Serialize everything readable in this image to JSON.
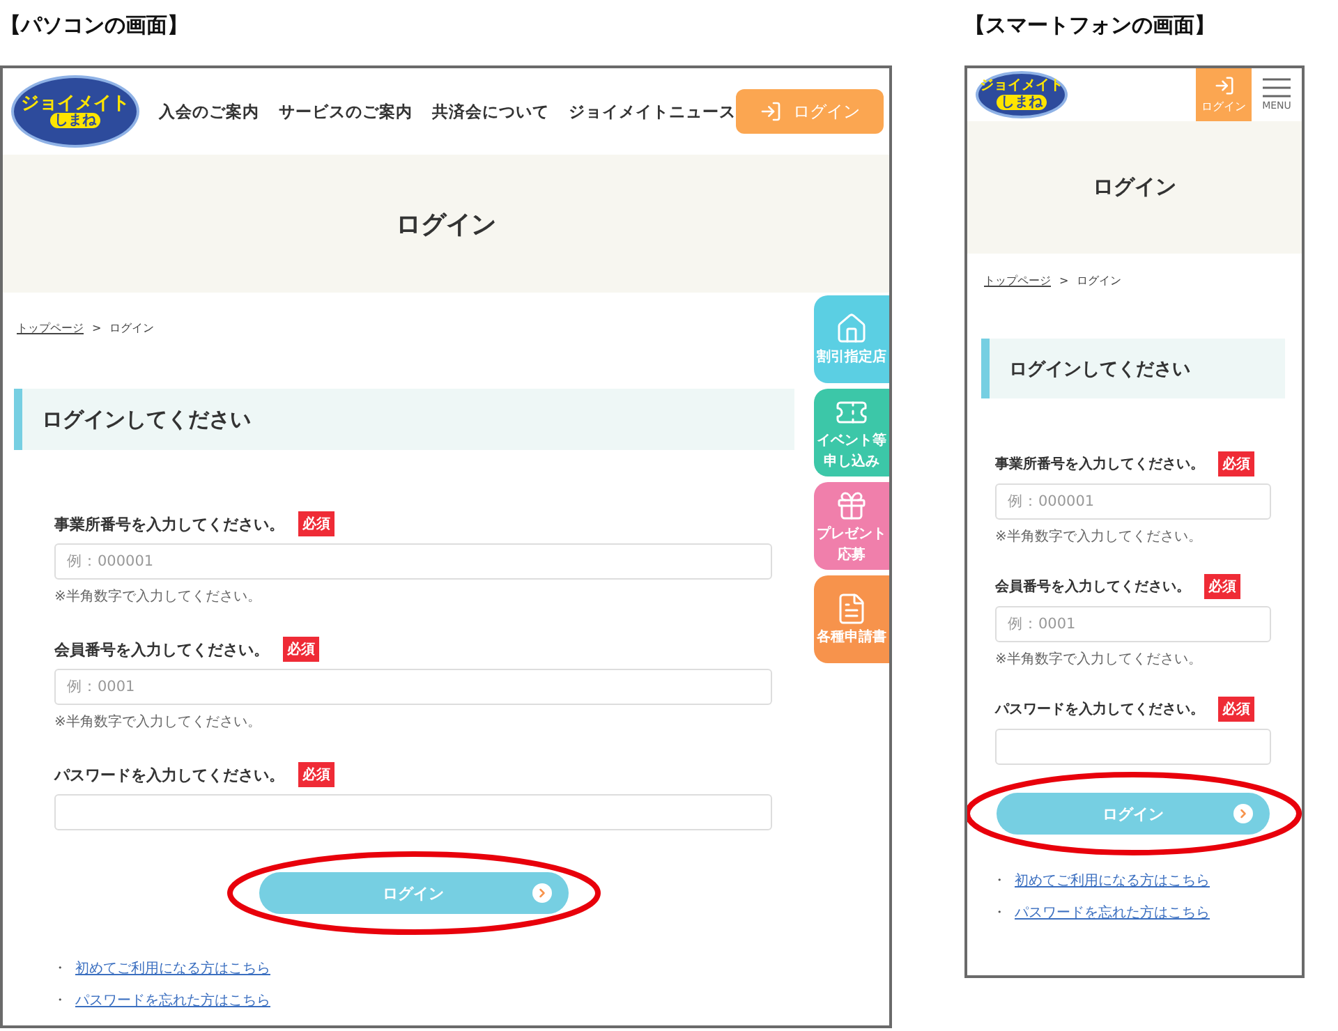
{
  "captions": [
    "【パソコンの画面】",
    "【スマートフォンの画面】"
  ],
  "desktop": {
    "logo": {
      "name": "ジョイメイト",
      "sub": "しまね"
    },
    "nav": [
      "入会のご案内",
      "サービスのご案内",
      "共済会について",
      "ジョイメイトニュース"
    ],
    "login_button": "ログイン",
    "page_title": "ログイン",
    "breadcrumb": {
      "home": "トップページ",
      "separator": ">",
      "current": "ログイン"
    },
    "section_heading": "ログインしてください",
    "fields": [
      {
        "label": "事業所番号を入力してください。",
        "badge": "必須",
        "placeholder": "例：000001",
        "note": "※半角数字で入力してください。"
      },
      {
        "label": "会員番号を入力してください。",
        "badge": "必須",
        "placeholder": "例：0001",
        "note": "※半角数字で入力してください。"
      },
      {
        "label": "パスワードを入力してください。",
        "badge": "必須"
      }
    ],
    "submit": {
      "label": "ログイン",
      "highlighted": true
    },
    "links": [
      {
        "bullet": "・",
        "label": "初めてご利用になる方はこちら"
      },
      {
        "bullet": "・",
        "label": "パスワードを忘れた方はこちら"
      }
    ],
    "side_tabs": [
      {
        "kind": "store",
        "lines": [
          "割引指定店"
        ],
        "color": "#5bcfe3"
      },
      {
        "kind": "event",
        "lines": [
          "イベント等",
          "申し込み"
        ],
        "color": "#3cc7a8"
      },
      {
        "kind": "gift",
        "lines": [
          "プレゼント",
          "応募"
        ],
        "color": "#f07fab"
      },
      {
        "kind": "document",
        "lines": [
          "各種申請書"
        ],
        "color": "#f7934c"
      }
    ]
  },
  "mobile": {
    "logo": {
      "name": "ジョイメイト",
      "sub": "しまね"
    },
    "login_button": "ログイン",
    "menu_label": "MENU",
    "page_title": "ログイン",
    "breadcrumb": {
      "home": "トップページ",
      "separator": ">",
      "current": "ログイン"
    },
    "section_heading": "ログインしてください",
    "fields": [
      {
        "label": "事業所番号を入力してください。",
        "badge": "必須",
        "placeholder": "例：000001",
        "note": "※半角数字で入力してください。"
      },
      {
        "label": "会員番号を入力してください。",
        "badge": "必須",
        "placeholder": "例：0001",
        "note": "※半角数字で入力してください。"
      },
      {
        "label": "パスワードを入力してください。",
        "badge": "必須"
      }
    ],
    "submit": {
      "label": "ログイン",
      "highlighted": true
    },
    "links": [
      {
        "bullet": "・",
        "label": "初めてご利用になる方はこちら"
      },
      {
        "bullet": "・",
        "label": "パスワードを忘れた方はこちら"
      }
    ]
  }
}
